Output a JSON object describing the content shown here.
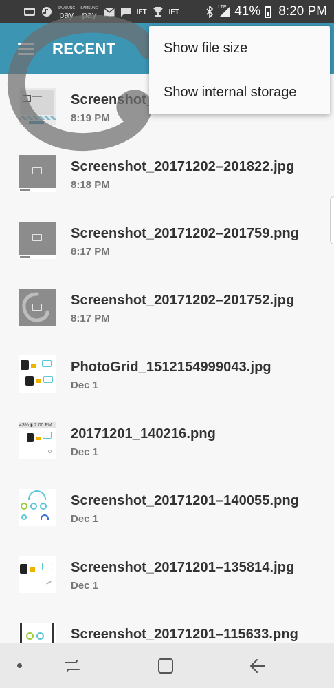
{
  "status_bar": {
    "pay_label_1": "pay",
    "pay_label_2": "pay",
    "pay_brand": "SAMSUNG",
    "ift_1": "IFT",
    "ift_2": "IFT",
    "network": "LTE",
    "battery_percent": "41%",
    "time": "8:20 PM"
  },
  "app_bar": {
    "title": "RECENT",
    "color": "#3d95b4"
  },
  "overflow_menu": {
    "items": [
      {
        "label": "Show file size"
      },
      {
        "label": "Show internal storage"
      }
    ]
  },
  "files": [
    {
      "name": "Screenshot_",
      "date": "8:19 PM",
      "thumb": "screenshot-settings"
    },
    {
      "name": "Screenshot_20171202–201822.jpg",
      "date": "8:18 PM",
      "thumb": "gray-image"
    },
    {
      "name": "Screenshot_20171202–201759.png",
      "date": "8:17 PM",
      "thumb": "gray-image"
    },
    {
      "name": "Screenshot_20171202–201752.jpg",
      "date": "8:17 PM",
      "thumb": "gray-scribble"
    },
    {
      "name": "PhotoGrid_1512154999043.jpg",
      "date": "Dec 1",
      "thumb": "watch-grid"
    },
    {
      "name": "20171201_140216.png",
      "date": "Dec 1",
      "thumb": "watch-screen"
    },
    {
      "name": "Screenshot_20171201–140055.png",
      "date": "Dec 1",
      "thumb": "health-stats"
    },
    {
      "name": "Screenshot_20171201–135814.jpg",
      "date": "Dec 1",
      "thumb": "watch-screen-2"
    },
    {
      "name": "Screenshot_20171201–115633.png",
      "date": "",
      "thumb": "watch-partial"
    }
  ],
  "thumb_text": {
    "watch_time": "43% ▮ 2:00 PM"
  },
  "nav_bar": {
    "recents": "recents-icon",
    "home": "home-icon",
    "back": "back-icon"
  }
}
